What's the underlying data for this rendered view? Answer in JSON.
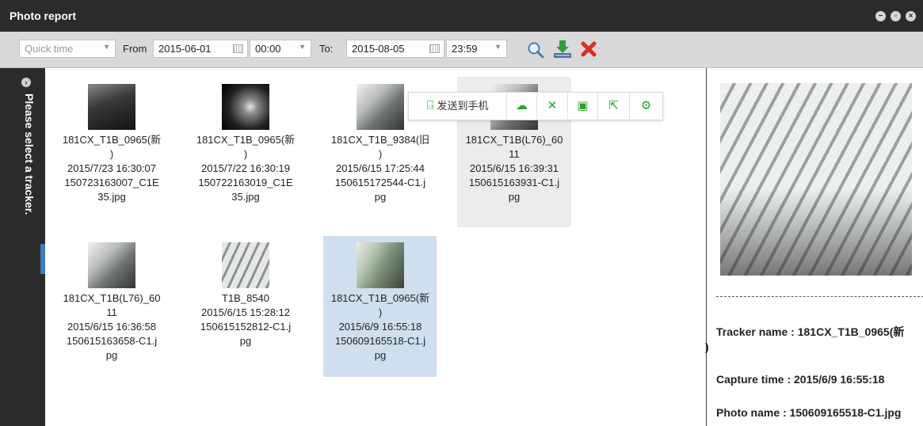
{
  "window": {
    "title": "Photo report"
  },
  "toolbar": {
    "quick_time": "Quick time",
    "from_label": "From",
    "from_date": "2015-06-01",
    "from_time": "00:00",
    "to_label": "To:",
    "to_date": "2015-08-05",
    "to_time": "23:59"
  },
  "leftbar": {
    "text": "Please select a tracker."
  },
  "photos": [
    {
      "name1": "181CX_T1B_0965(新",
      "name2": ")",
      "time": "2015/7/23 16:30:07",
      "file1": "150723163007_C1E",
      "file2": "35.jpg"
    },
    {
      "name1": "181CX_T1B_0965(新",
      "name2": ")",
      "time": "2015/7/22 16:30:19",
      "file1": "150722163019_C1E",
      "file2": "35.jpg"
    },
    {
      "name1": "181CX_T1B_9384(旧",
      "name2": ")",
      "time": "2015/6/15 17:25:44",
      "file1": "150615172544-C1.j",
      "file2": "pg"
    },
    {
      "name1": "181CX_T1B(L76)_60",
      "name2": "11",
      "time": "2015/6/15 16:39:31",
      "file1": "150615163931-C1.j",
      "file2": "pg"
    },
    {
      "name1": "181CX_T1B(L76)_60",
      "name2": "11",
      "time": "2015/6/15 16:36:58",
      "file1": "150615163658-C1.j",
      "file2": "pg"
    },
    {
      "name1": "T1B_8540",
      "name2": "",
      "time": "2015/6/15 15:28:12",
      "file1": "150615152812-C1.j",
      "file2": "pg"
    },
    {
      "name1": "181CX_T1B_0965(新",
      "name2": ")",
      "time": "2015/6/9 16:55:18",
      "file1": "150609165518-C1.j",
      "file2": "pg"
    }
  ],
  "popup": {
    "send_label": "发送到手机"
  },
  "preview": {
    "tracker_name": "Tracker name : 181CX_T1B_0965(新",
    "tracker_name_wrap": ")",
    "capture_time": "Capture time : 2015/6/9 16:55:18",
    "photo_name": "Photo name : 150609165518-C1.jpg"
  },
  "colors": {
    "titlebar": "#2b2b2b",
    "toolbar": "#d9d9d9",
    "selected": "#d0dff0",
    "accent_green": "#29a329",
    "delete_red": "#d9301f"
  }
}
